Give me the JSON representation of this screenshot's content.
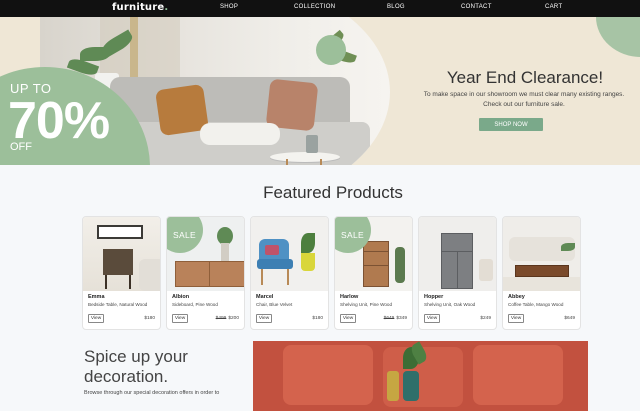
{
  "nav": {
    "logo": "furniture",
    "logo_dot": ".",
    "links": [
      "SHOP",
      "COLLECTION",
      "BLOG",
      "CONTACT",
      "CART"
    ]
  },
  "hero": {
    "promo_upto": "UP TO",
    "promo_percent": "70%",
    "promo_off": "OFF",
    "title": "Year End Clearance!",
    "text_line1": "To make space in our showroom we must clear many existing ranges.",
    "text_line2": "Check out our furniture sale.",
    "button": "SHOP NOW"
  },
  "featured": {
    "title": "Featured Products",
    "view_label": "View",
    "sale_label": "SALE",
    "products": [
      {
        "name": "Emma",
        "desc": "Bedside Table, Natural Wood",
        "price": "$180",
        "old_price": "",
        "sale": false
      },
      {
        "name": "Albion",
        "desc": "Sideboard, Pine Wood",
        "price": "$200",
        "old_price": "$499",
        "sale": true
      },
      {
        "name": "Marcel",
        "desc": "Chair, Blue Velvet",
        "price": "$180",
        "old_price": "",
        "sale": false
      },
      {
        "name": "Harlow",
        "desc": "Shelving Unit, Pine Wood",
        "price": "$349",
        "old_price": "$649",
        "sale": true
      },
      {
        "name": "Hopper",
        "desc": "Shelving Unit, Oak Wood",
        "price": "$249",
        "old_price": "",
        "sale": false
      },
      {
        "name": "Abbey",
        "desc": "Coffee Table, Mango Wood",
        "price": "$649",
        "old_price": "",
        "sale": false
      }
    ]
  },
  "spice": {
    "title_line1": "Spice up your",
    "title_line2": "decoration.",
    "text": "Browse through our special decoration offers in order to"
  },
  "colors": {
    "accent_green": "#9cbf9a",
    "button_green": "#7aa98a",
    "nav_bg": "#111111",
    "hero_bg": "#efe7d6"
  }
}
